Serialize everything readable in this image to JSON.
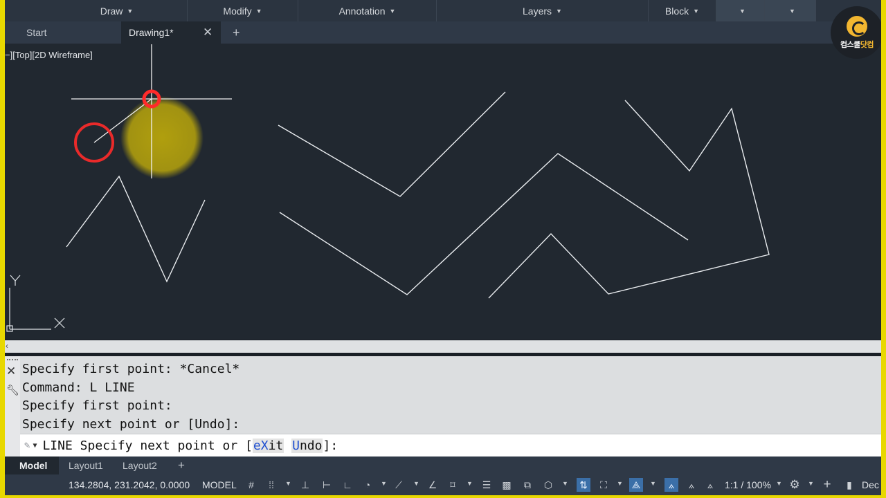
{
  "ribbon": {
    "panels": [
      {
        "label": "Draw"
      },
      {
        "label": "Modify"
      },
      {
        "label": "Annotation"
      },
      {
        "label": "Layers"
      },
      {
        "label": "Block"
      }
    ]
  },
  "tabs": {
    "start": "Start",
    "drawing": "Drawing1*",
    "close_glyph": "✕",
    "add_glyph": "+"
  },
  "viewport": {
    "label": "−][Top][2D Wireframe]",
    "ucs_x": "X",
    "ucs_y": "Y"
  },
  "logo": {
    "brand_a": "컴스쿨",
    "brand_b": "닷컴"
  },
  "command": {
    "history": [
      "Specify first point: *Cancel*",
      "Command: L LINE",
      "Specify first point:",
      "Specify next point or [Undo]:"
    ],
    "prompt_prefix": "LINE Specify next point or [",
    "option1_hot": "eX",
    "option1_rest": "it",
    "option2_hot": "U",
    "option2_rest": "ndo",
    "prompt_suffix": "]:"
  },
  "layout_tabs": [
    "Model",
    "Layout1",
    "Layout2"
  ],
  "status": {
    "coordinates": "134.2804, 231.2042, 0.0000",
    "space": "MODEL",
    "annotation_scale": "1:1 / 100%",
    "units": "Dec"
  },
  "colors": {
    "canvas": "#212830",
    "frame": "#e8d800",
    "cursor_marker": "#ff2a2a",
    "click_marker": "#b8a50c"
  }
}
